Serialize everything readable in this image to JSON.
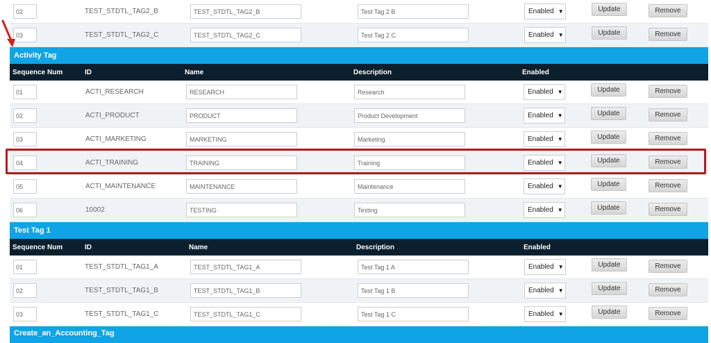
{
  "options": {
    "enabled": "Enabled"
  },
  "buttons": {
    "update": "Update",
    "remove": "Remove"
  },
  "headers": {
    "seq": "Sequence Num",
    "id": "ID",
    "name": "Name",
    "description": "Description",
    "enabled": "Enabled"
  },
  "section_prev": {
    "rows": [
      {
        "seq": "02",
        "id": "TEST_STDTL_TAG2_B",
        "name": "TEST_STDTL_TAG2_B",
        "desc": "Test Tag 2 B",
        "enabled": "Enabled"
      },
      {
        "seq": "03",
        "id": "TEST_STDTL_TAG2_C",
        "name": "TEST_STDTL_TAG2_C",
        "desc": "Test Tag 2 C",
        "enabled": "Enabled"
      }
    ]
  },
  "section_activity": {
    "title": "Activity Tag",
    "rows": [
      {
        "seq": "01",
        "id": "ACTI_RESEARCH",
        "name": "RESEARCH",
        "desc": "Research",
        "enabled": "Enabled"
      },
      {
        "seq": "02",
        "id": "ACTI_PRODUCT",
        "name": "PRODUCT",
        "desc": "Product Development",
        "enabled": "Enabled"
      },
      {
        "seq": "03",
        "id": "ACTI_MARKETING",
        "name": "MARKETING",
        "desc": "Marketing",
        "enabled": "Enabled"
      },
      {
        "seq": "04",
        "id": "ACTI_TRAINING",
        "name": "TRAINING",
        "desc": "Training",
        "enabled": "Enabled"
      },
      {
        "seq": "05",
        "id": "ACTI_MAINTENANCE",
        "name": "MAINTENANCE",
        "desc": "Maintenance",
        "enabled": "Enabled"
      },
      {
        "seq": "06",
        "id": "10002",
        "name": "TESTING",
        "desc": "Testing",
        "enabled": "Enabled"
      }
    ]
  },
  "section_tag1": {
    "title": "Test Tag 1",
    "rows": [
      {
        "seq": "01",
        "id": "TEST_STDTL_TAG1_A",
        "name": "TEST_STDTL_TAG1_A",
        "desc": "Test Tag 1 A",
        "enabled": "Enabled"
      },
      {
        "seq": "02",
        "id": "TEST_STDTL_TAG1_B",
        "name": "TEST_STDTL_TAG1_B",
        "desc": "Test Tag 1 B",
        "enabled": "Enabled"
      },
      {
        "seq": "03",
        "id": "TEST_STDTL_TAG1_C",
        "name": "TEST_STDTL_TAG1_C",
        "desc": "Test Tag 1 C",
        "enabled": "Enabled"
      }
    ]
  },
  "section_next": {
    "title": "Create_an_Accounting_Tag"
  },
  "colors": {
    "section_bar": "#0fa4e6",
    "header_bar": "#0b1f2e",
    "highlight": "#b51c1c",
    "arrow": "#d61f1f"
  }
}
